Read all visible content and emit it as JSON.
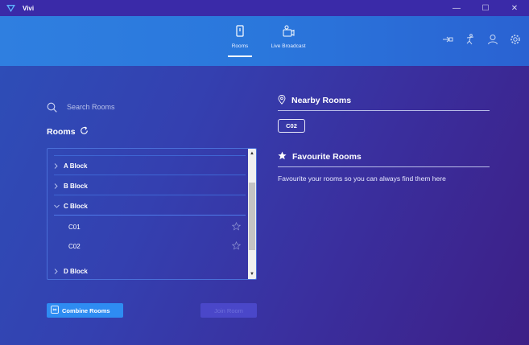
{
  "window": {
    "title": "Vivi",
    "minimize": "—",
    "maximize": "☐",
    "close": "✕"
  },
  "nav": {
    "tabs": [
      {
        "label": "Rooms",
        "active": true
      },
      {
        "label": "Live Broadcast",
        "active": false
      }
    ],
    "icons": [
      "cast-icon",
      "accessibility-icon",
      "user-icon",
      "gear-icon"
    ]
  },
  "search": {
    "placeholder": "Search Rooms",
    "value": ""
  },
  "rooms": {
    "heading": "Rooms",
    "list": [
      {
        "type": "block",
        "label": "A Block",
        "expanded": false
      },
      {
        "type": "block",
        "label": "B Block",
        "expanded": false
      },
      {
        "type": "block",
        "label": "C Block",
        "expanded": true
      },
      {
        "type": "room",
        "label": "C01",
        "favourite": false
      },
      {
        "type": "room",
        "label": "C02",
        "favourite": false
      },
      {
        "type": "block",
        "label": "D Block",
        "expanded": false
      }
    ]
  },
  "buttons": {
    "combine": "Combine Rooms",
    "join": "Join Room"
  },
  "nearby": {
    "heading": "Nearby Rooms",
    "rooms": [
      "C02"
    ]
  },
  "favourites": {
    "heading": "Favourite Rooms",
    "empty_text": "Favourite your rooms so you can always find them here"
  },
  "colors": {
    "accent": "#2e8cf2",
    "navbar": "#2a77dc",
    "titlebar": "#3a2aa8"
  }
}
